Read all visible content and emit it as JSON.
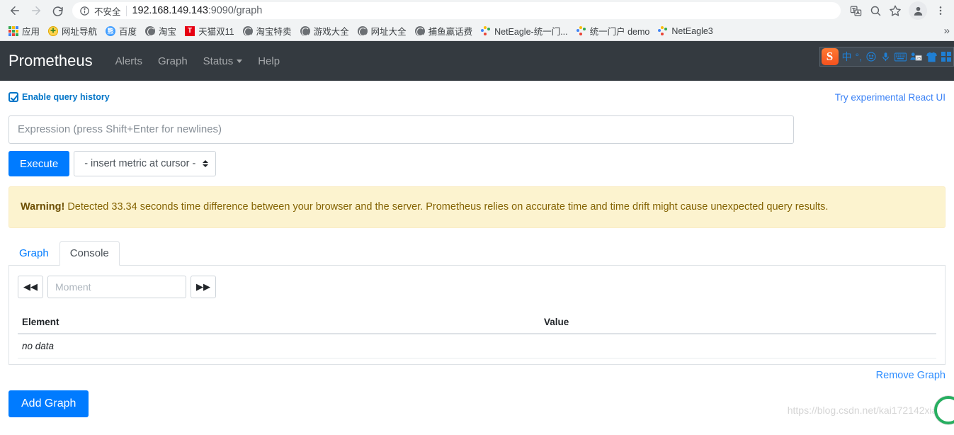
{
  "browser": {
    "back_icon": "back-arrow-icon",
    "forward_icon": "forward-arrow-icon",
    "reload_icon": "reload-icon",
    "security_label": "不安全",
    "url_host": "192.168.149.143",
    "url_rest": ":9090/graph",
    "toolbar_icons": [
      "translate-icon",
      "zoom-out-icon",
      "bookmark-star-icon",
      "profile-avatar",
      "chrome-menu-icon"
    ],
    "bookmarks": [
      {
        "label": "应用",
        "icon": "apps-grid-icon"
      },
      {
        "label": "网址导航",
        "icon": "green-plus-circle-icon"
      },
      {
        "label": "百度",
        "icon": "baidu-paw-icon"
      },
      {
        "label": "淘宝",
        "icon": "globe-icon"
      },
      {
        "label": "天猫双11",
        "icon": "tmall-t-icon"
      },
      {
        "label": "淘宝特卖",
        "icon": "globe-icon"
      },
      {
        "label": "游戏大全",
        "icon": "globe-icon"
      },
      {
        "label": "网址大全",
        "icon": "globe-icon"
      },
      {
        "label": "捕鱼赢话费",
        "icon": "globe-icon"
      },
      {
        "label": "NetEagle-统一门...",
        "icon": "dots-favicon-icon"
      },
      {
        "label": "统一门户 demo",
        "icon": "dots-favicon-icon"
      },
      {
        "label": "NetEagle3",
        "icon": "dots-favicon-icon"
      }
    ],
    "bookmarks_overflow": "»"
  },
  "navbar": {
    "brand": "Prometheus",
    "links": [
      {
        "label": "Alerts",
        "has_caret": false
      },
      {
        "label": "Graph",
        "has_caret": false
      },
      {
        "label": "Status",
        "has_caret": true
      },
      {
        "label": "Help",
        "has_caret": false
      }
    ]
  },
  "ime_toolbar": {
    "logo": "S",
    "items": [
      "中",
      "°,",
      "smiley-icon",
      "microphone-icon",
      "keyboard-icon",
      "user-card-icon",
      "shirt-skin-icon",
      "more-blocks-icon"
    ]
  },
  "query": {
    "history_checkbox_label": "Enable query history",
    "history_checkbox_checked": true,
    "react_ui_link": "Try experimental React UI",
    "expression_value": "",
    "expression_placeholder": "Expression (press Shift+Enter for newlines)",
    "execute_label": "Execute",
    "metric_select_value": "- insert metric at cursor -"
  },
  "alert": {
    "title": "Warning!",
    "message": " Detected 33.34 seconds time difference between your browser and the server. Prometheus relies on accurate time and time drift might cause unexpected query results."
  },
  "tabs": [
    {
      "label": "Graph",
      "active": false
    },
    {
      "label": "Console",
      "active": true
    }
  ],
  "console": {
    "prev_label": "◀◀",
    "next_label": "▶▶",
    "moment_value": "",
    "moment_placeholder": "Moment",
    "table": {
      "headers": [
        "Element",
        "Value"
      ],
      "rows": [
        [
          "no data",
          ""
        ]
      ]
    }
  },
  "footer": {
    "remove_graph_label": "Remove Graph",
    "add_graph_label": "Add Graph",
    "watermark": "https://blog.csdn.net/kai172142xiang"
  },
  "colors": {
    "primary": "#007bff",
    "navbar_bg": "#343a40",
    "warning_bg": "#fcf3cf",
    "warning_text": "#856404",
    "link": "#0275c8"
  }
}
